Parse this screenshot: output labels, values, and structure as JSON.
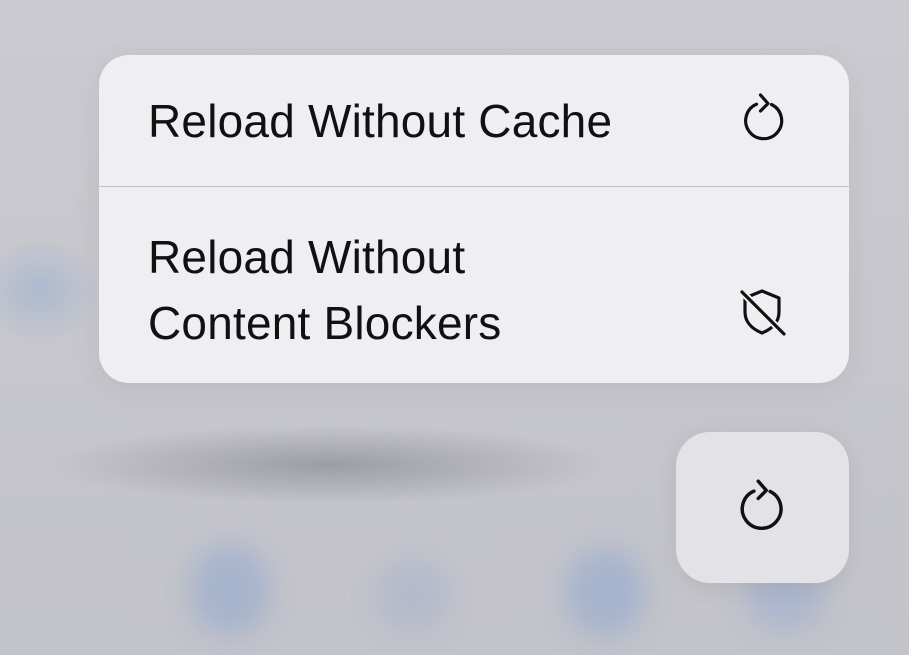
{
  "menu": {
    "items": [
      {
        "label": "Reload Without Cache",
        "icon": "reload-icon"
      },
      {
        "label": "Reload Without Content Blockers",
        "icon": "shield-slash-icon"
      }
    ]
  },
  "toolbar": {
    "reload_icon": "reload-icon"
  },
  "colors": {
    "menu_background": "#efeff1",
    "text": "#111113",
    "button_background": "#e3e3e7"
  }
}
